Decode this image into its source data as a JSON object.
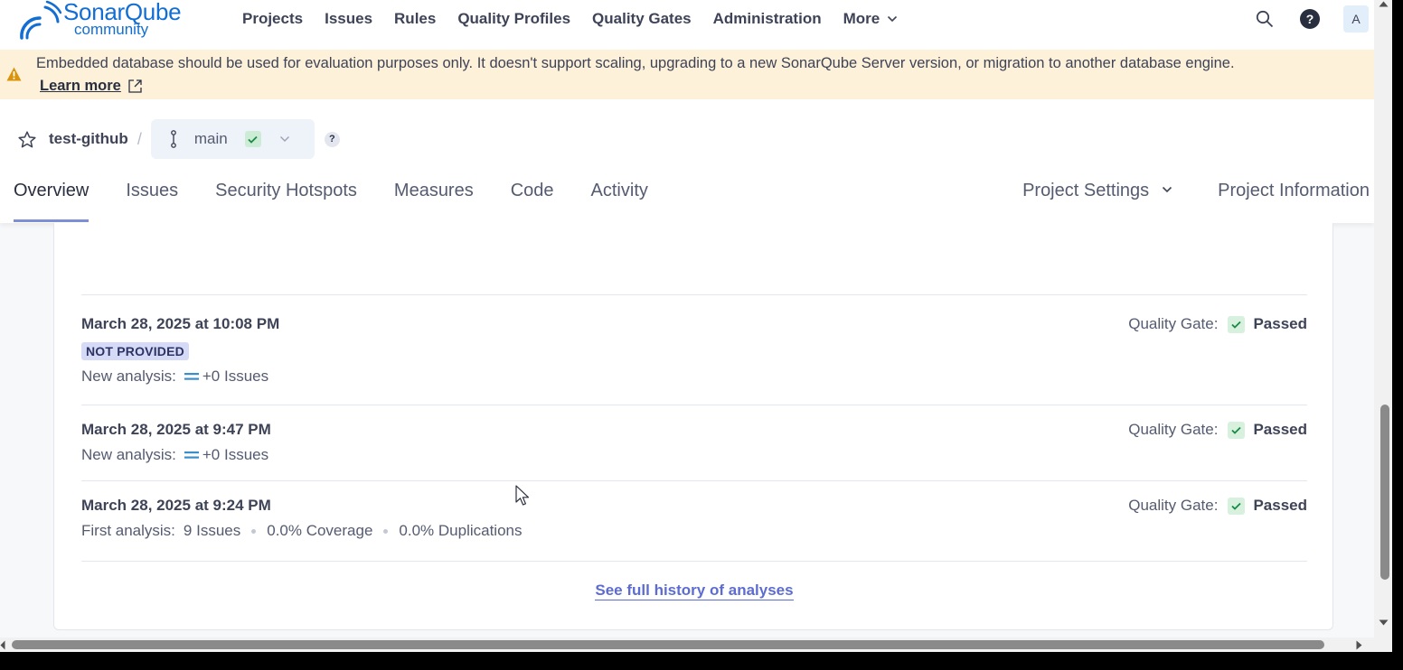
{
  "app": {
    "logo_name": "SonarQube",
    "logo_edition": "community"
  },
  "nav": {
    "items": [
      {
        "label": "Projects"
      },
      {
        "label": "Issues"
      },
      {
        "label": "Rules"
      },
      {
        "label": "Quality Profiles"
      },
      {
        "label": "Quality Gates"
      },
      {
        "label": "Administration"
      },
      {
        "label": "More"
      }
    ],
    "help": "?",
    "avatar": "A"
  },
  "banner": {
    "text": "Embedded database should be used for evaluation purposes only. It doesn't support scaling, upgrading to a new SonarQube Server version, or migration to another database engine.",
    "link": "Learn more"
  },
  "project": {
    "name": "test-github",
    "separator": "/",
    "branch": "main",
    "help": "?"
  },
  "tabs": {
    "items": [
      {
        "label": "Overview"
      },
      {
        "label": "Issues"
      },
      {
        "label": "Security Hotspots"
      },
      {
        "label": "Measures"
      },
      {
        "label": "Code"
      },
      {
        "label": "Activity"
      }
    ],
    "settings": "Project Settings",
    "info": "Project Information"
  },
  "analyses": [
    {
      "date": "March 28, 2025 at 10:08 PM",
      "badge": "NOT PROVIDED",
      "meta_label": "New analysis:",
      "meta_value": "+0 Issues",
      "qg_label": "Quality Gate:",
      "qg_status": "Passed"
    },
    {
      "date": "March 28, 2025 at 9:47 PM",
      "meta_label": "New analysis:",
      "meta_value": "+0 Issues",
      "qg_label": "Quality Gate:",
      "qg_status": "Passed"
    },
    {
      "date": "March 28, 2025 at 9:24 PM",
      "meta_label": "First analysis:",
      "issues": "9 Issues",
      "coverage": "0.0% Coverage",
      "duplications": "0.0% Duplications",
      "qg_label": "Quality Gate:",
      "qg_status": "Passed"
    }
  ],
  "history_link": "See full history of analyses",
  "colors": {
    "brand": "#126ed3",
    "banner_bg": "#fdf1d9",
    "accent": "#5d6cd0",
    "passed": "#d7f1de"
  }
}
